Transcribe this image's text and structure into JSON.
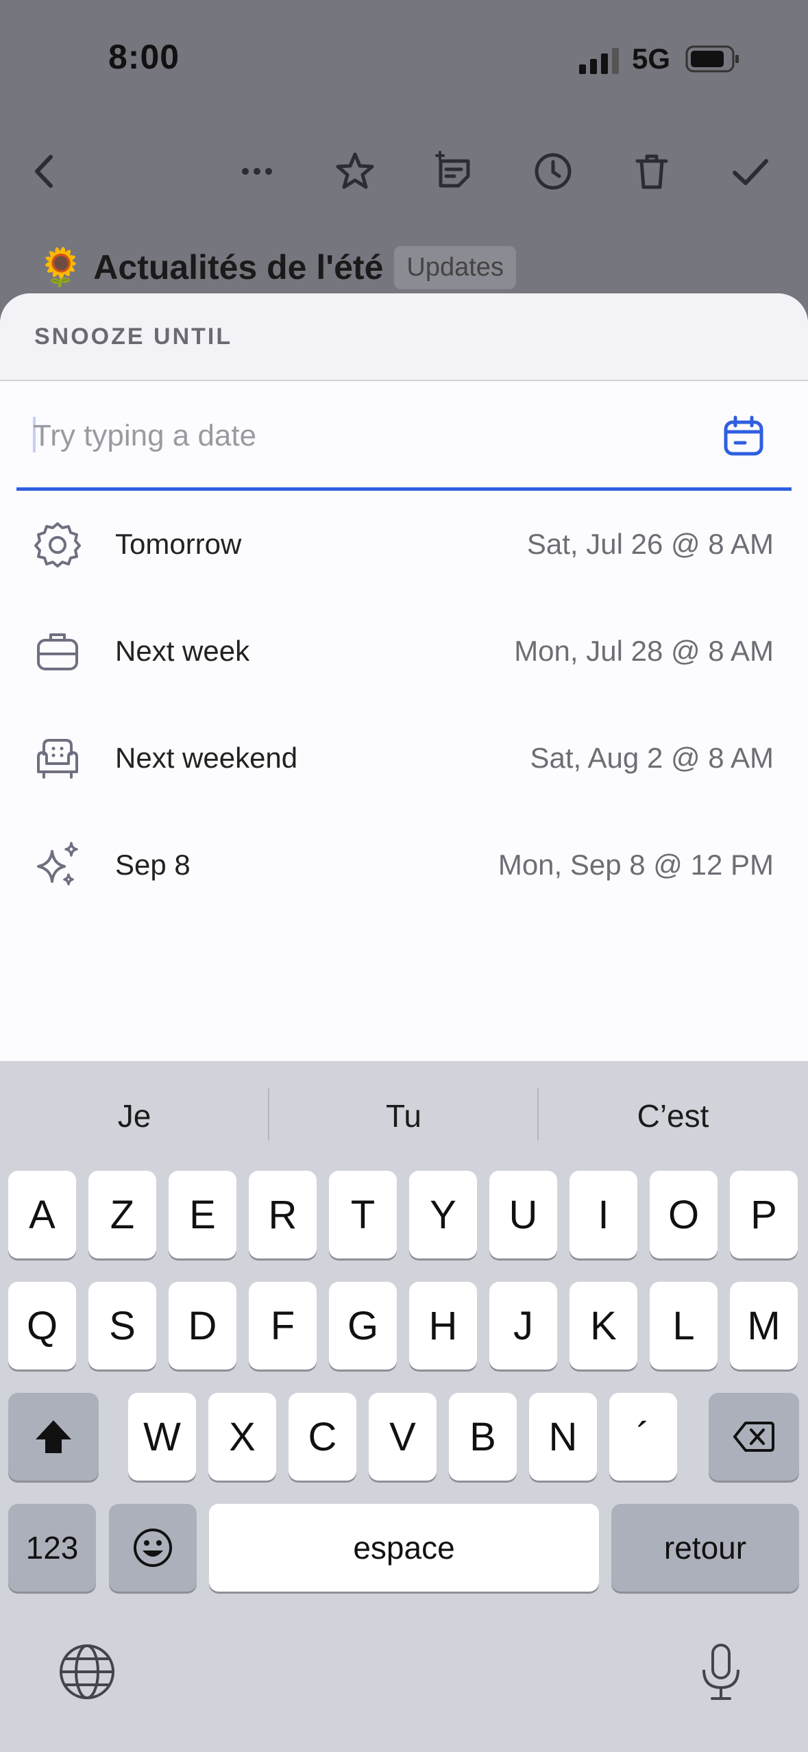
{
  "status": {
    "time": "8:00",
    "network": "5G"
  },
  "toolbar": {
    "icons": [
      "back-icon",
      "more-icon",
      "star-icon",
      "note-add-icon",
      "clock-icon",
      "trash-icon",
      "check-icon"
    ]
  },
  "email": {
    "emoji": "🌻",
    "title": "Actualités de l'été",
    "tag": "Updates"
  },
  "sheet": {
    "title": "SNOOZE UNTIL",
    "input_placeholder": "Try typing a date",
    "input_value": "",
    "options": [
      {
        "label": "Tomorrow",
        "date": "Sat, Jul 26 @ 8 AM",
        "icon": "gear-icon"
      },
      {
        "label": "Next week",
        "date": "Mon, Jul 28 @ 8 AM",
        "icon": "briefcase-icon"
      },
      {
        "label": "Next weekend",
        "date": "Sat, Aug 2 @ 8 AM",
        "icon": "armchair-icon"
      },
      {
        "label": "Sep 8",
        "date": "Mon, Sep 8 @ 12 PM",
        "icon": "sparkles-icon"
      }
    ]
  },
  "keyboard": {
    "suggestions": [
      "Je",
      "Tu",
      "C’est"
    ],
    "row1": [
      "A",
      "Z",
      "E",
      "R",
      "T",
      "Y",
      "U",
      "I",
      "O",
      "P"
    ],
    "row2": [
      "Q",
      "S",
      "D",
      "F",
      "G",
      "H",
      "J",
      "K",
      "L",
      "M"
    ],
    "row3": [
      "W",
      "X",
      "C",
      "V",
      "B",
      "N",
      "´"
    ],
    "numbers": "123",
    "space": "espace",
    "return": "retour"
  }
}
